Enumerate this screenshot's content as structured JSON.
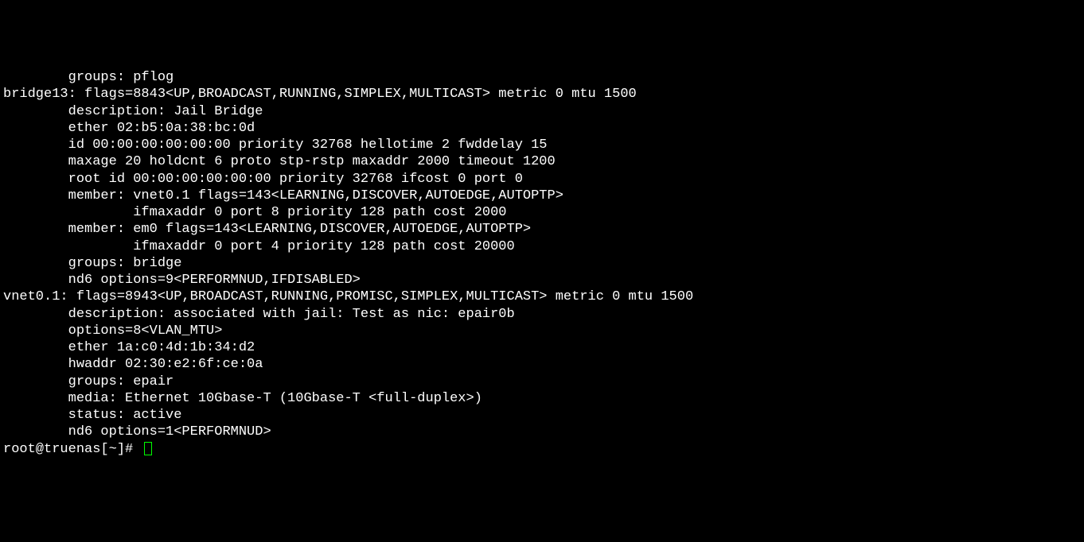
{
  "lines": [
    "        groups: pflog",
    "bridge13: flags=8843<UP,BROADCAST,RUNNING,SIMPLEX,MULTICAST> metric 0 mtu 1500",
    "        description: Jail Bridge",
    "        ether 02:b5:0a:38:bc:0d",
    "        id 00:00:00:00:00:00 priority 32768 hellotime 2 fwddelay 15",
    "        maxage 20 holdcnt 6 proto stp-rstp maxaddr 2000 timeout 1200",
    "        root id 00:00:00:00:00:00 priority 32768 ifcost 0 port 0",
    "        member: vnet0.1 flags=143<LEARNING,DISCOVER,AUTOEDGE,AUTOPTP>",
    "                ifmaxaddr 0 port 8 priority 128 path cost 2000",
    "        member: em0 flags=143<LEARNING,DISCOVER,AUTOEDGE,AUTOPTP>",
    "                ifmaxaddr 0 port 4 priority 128 path cost 20000",
    "        groups: bridge",
    "        nd6 options=9<PERFORMNUD,IFDISABLED>",
    "vnet0.1: flags=8943<UP,BROADCAST,RUNNING,PROMISC,SIMPLEX,MULTICAST> metric 0 mtu 1500",
    "        description: associated with jail: Test as nic: epair0b",
    "        options=8<VLAN_MTU>",
    "        ether 1a:c0:4d:1b:34:d2",
    "        hwaddr 02:30:e2:6f:ce:0a",
    "        groups: epair",
    "        media: Ethernet 10Gbase-T (10Gbase-T <full-duplex>)",
    "        status: active",
    "        nd6 options=1<PERFORMNUD>"
  ],
  "prompt": "root@truenas[~]# "
}
